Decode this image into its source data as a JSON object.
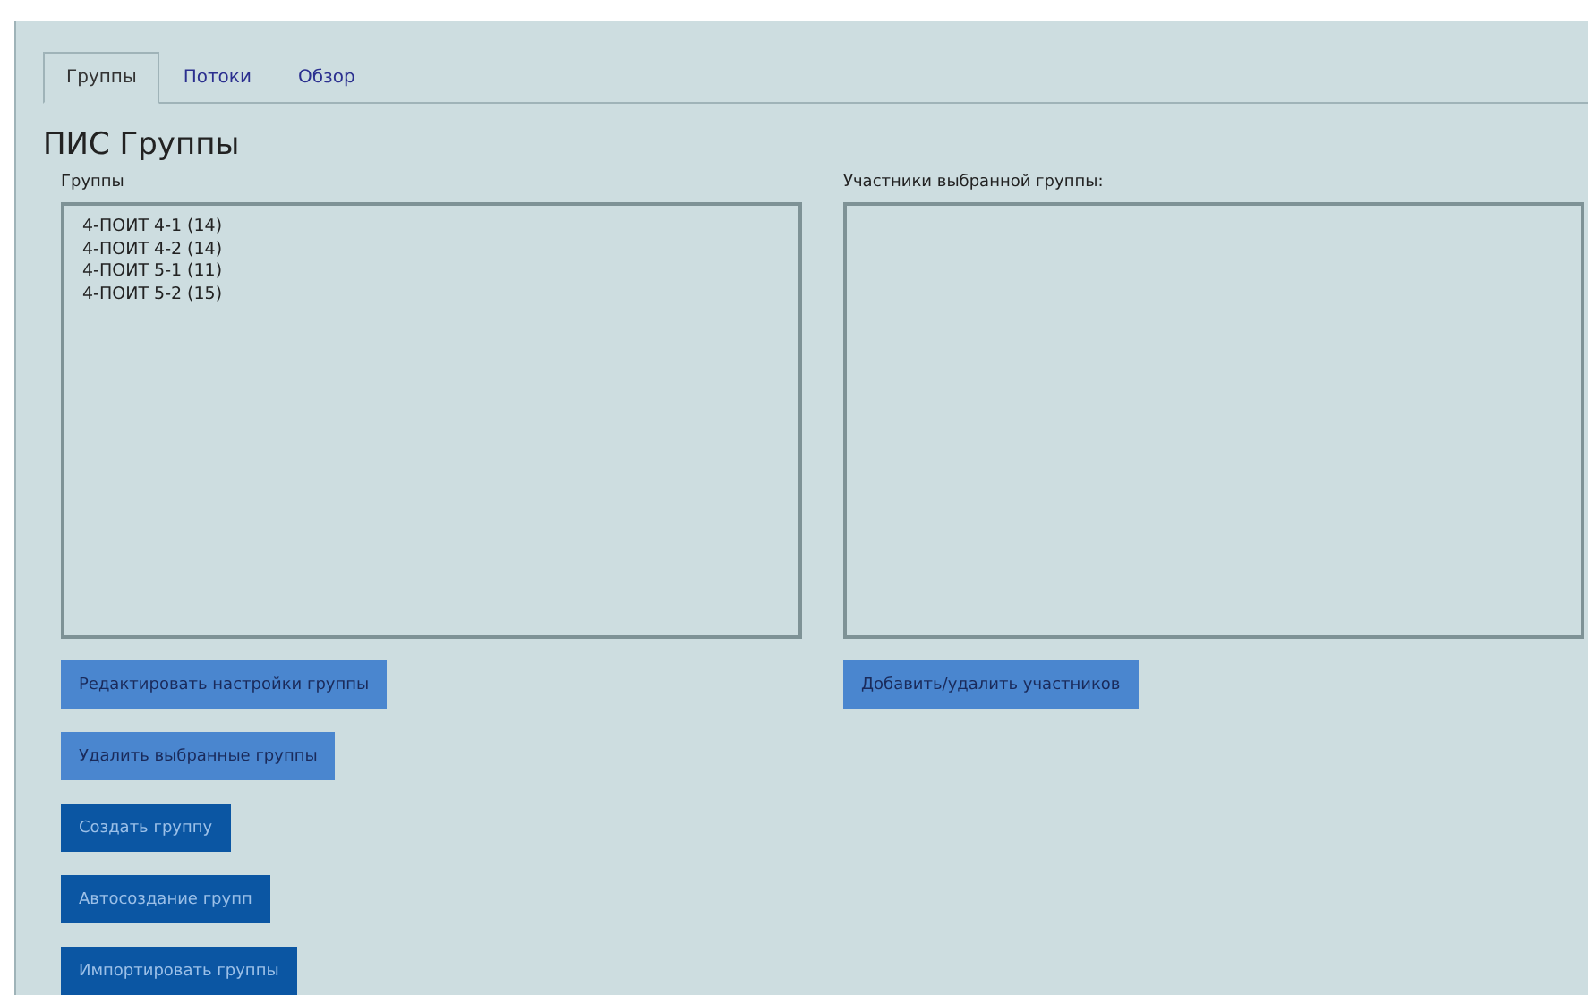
{
  "tabs": [
    {
      "label": "Группы",
      "selected": true
    },
    {
      "label": "Потоки",
      "selected": false
    },
    {
      "label": "Обзор",
      "selected": false
    }
  ],
  "title": "ПИС Группы",
  "groups_panel": {
    "label": "Группы",
    "items": [
      "4-ПОИТ 4-1 (14)",
      "4-ПОИТ 4-2 (14)",
      "4-ПОИТ 5-1 (11)",
      "4-ПОИТ 5-2 (15)"
    ],
    "buttons": [
      {
        "label": "Редактировать настройки группы",
        "kind": "light"
      },
      {
        "label": "Удалить выбранные группы",
        "kind": "light"
      },
      {
        "label": "Создать группу",
        "kind": "dark"
      },
      {
        "label": "Автосоздание групп",
        "kind": "dark"
      },
      {
        "label": "Импортировать группы",
        "kind": "dark"
      }
    ]
  },
  "members_panel": {
    "label": "Участники выбранной группы:",
    "buttons": [
      {
        "label": "Добавить/удалить участников",
        "kind": "light"
      }
    ]
  }
}
